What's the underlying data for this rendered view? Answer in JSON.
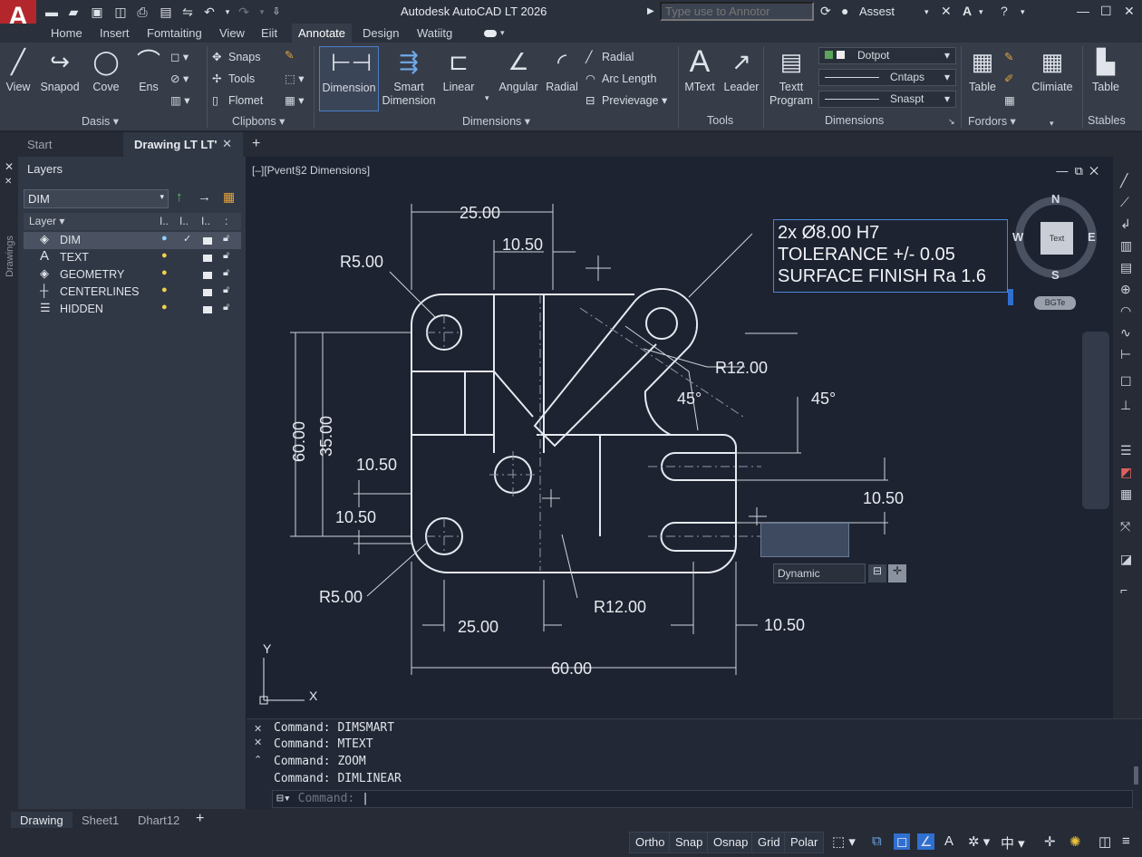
{
  "app": {
    "title": "Autodesk AutoCAD LT 2026",
    "logo_letter": "A",
    "search_placeholder": "Type use to Annotor",
    "account": "Assest"
  },
  "menu_tabs": [
    "Home",
    "Insert",
    "Fomtaiting",
    "View",
    "Eiit",
    "Annotate",
    "Design",
    "Watiitg"
  ],
  "ribbon": {
    "draw_buttons": [
      "View",
      "Snapod",
      "Cove",
      "Ens"
    ],
    "draw_group_title": "Dasis",
    "clip_items": [
      "Snaps",
      "Tools",
      "Flomet"
    ],
    "clip_group_title": "Clipbons",
    "dim_buttons": [
      "Dimension",
      "Smart\nDimension",
      "Linear",
      "Angular",
      "Radial"
    ],
    "dim_small": [
      "Radial",
      "Arc Length",
      "Previevage"
    ],
    "dim_group_title": "Dimensions",
    "tools_buttons": [
      "MText",
      "Leader"
    ],
    "tools_group_title": "Tools",
    "text_prog": "Textt\nProgram",
    "style_dropdowns": [
      "Dotpot",
      "Cntaps",
      "Snaspt"
    ],
    "style_group_title": "Dimensions",
    "table_btn": "Table",
    "fordors_title": "Fordors",
    "climate_btn": "Climiate",
    "table2_btn": "Table",
    "stables_title": "Stables"
  },
  "doc_tabs": {
    "start": "Start",
    "drawing": "Drawing LT LT'"
  },
  "layers": {
    "title": "Layers",
    "current": "DIM",
    "header": "Layer",
    "side_label": "Drawings",
    "rows": [
      {
        "name": "DIM",
        "icon": "layers-icon"
      },
      {
        "name": "TEXT",
        "icon": "text-icon"
      },
      {
        "name": "GEOMETRY",
        "icon": "layers-icon"
      },
      {
        "name": "CENTERLINES",
        "icon": "cross-icon"
      },
      {
        "name": "HIDDEN",
        "icon": "lines-icon"
      }
    ]
  },
  "viewport": {
    "label": "[–][Pvent§2 Dimensions]"
  },
  "drawing": {
    "dims": {
      "top_25": "25.00",
      "top_10_50": "10.50",
      "r5_top": "R5.00",
      "r12_right": "R12.00",
      "ang45_a": "45°",
      "ang45_b": "45°",
      "v60": "60.00",
      "v35": "35.00",
      "h10_50_a": "10.50",
      "h10_50_b": "10.50",
      "r10_50_right": "10.50",
      "r5_bottom": "R5.00",
      "r12_bottom": "R12.00",
      "bot_25": "25.00",
      "bot_10_50": "10.50",
      "bot_60": "60.00"
    },
    "note": [
      "2x Ø8.00 H7",
      "TOLERANCE +/- 0.05",
      "SURFACE FINISH Ra 1.6"
    ],
    "dynamic_label": "Dynamic",
    "ucs_x": "X",
    "ucs_y": "Y"
  },
  "viewcube": {
    "n": "N",
    "s": "S",
    "e": "E",
    "w": "W",
    "face": "Text",
    "badge": "BGTe"
  },
  "commands": [
    "Command: DIMSMART",
    "Command: MTEXT",
    "Command: ZOOM",
    "Command: DIMLINEAR"
  ],
  "command_prompt": "Command:",
  "layout_tabs": [
    "Drawing",
    "Sheet1",
    "Dhart12"
  ],
  "status": [
    "Ortho",
    "Snap",
    "Osnap",
    "Grid",
    "Polar"
  ],
  "colors": {
    "accent": "#3d7bd6",
    "bg": "#1d2331",
    "brand": "#b3272c",
    "bulb": "#f2d24a"
  }
}
